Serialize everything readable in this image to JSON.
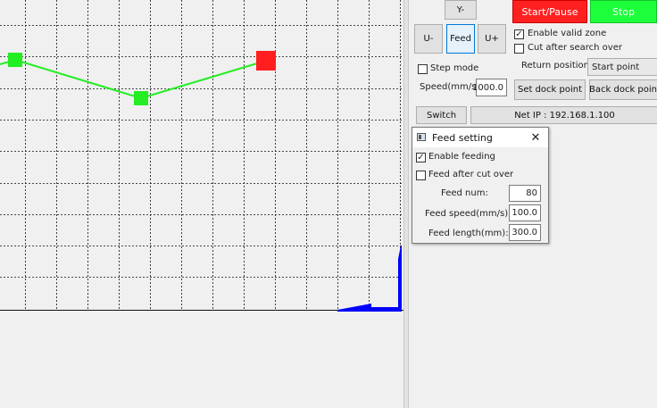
{
  "jog": {
    "y_minus": "Y-",
    "u_minus": "U-",
    "feed": "Feed",
    "u_plus": "U+"
  },
  "controls": {
    "start_pause": "Start/Pause",
    "stop": "Stop",
    "start_color": "#ff2020",
    "stop_color": "#1eff3c"
  },
  "options": {
    "enable_valid_zone": {
      "label": "Enable valid zone",
      "checked": true
    },
    "cut_after_search_over": {
      "label": "Cut after search over",
      "checked": false
    },
    "return_position_label": "Return position:",
    "return_position_value": "Start point",
    "step_mode": {
      "label": "Step mode",
      "checked": false
    },
    "speed_label": "Speed(mm/s):",
    "speed_value": "1000.0",
    "set_dock_point": "Set dock point",
    "back_dock_point": "Back dock point"
  },
  "network": {
    "switch_label": "Switch",
    "net_ip": "Net IP : 192.168.1.100"
  },
  "feed_dialog": {
    "title": "Feed setting",
    "close_glyph": "✕",
    "enable_feeding": {
      "label": "Enable feeding",
      "checked": true
    },
    "feed_after_cut_over": {
      "label": "Feed after cut over",
      "checked": false
    },
    "feed_num_label": "Feed num:",
    "feed_num_value": "80",
    "feed_speed_label": "Feed speed(mm/s):",
    "feed_speed_value": "100.0",
    "feed_length_label": "Feed length(mm):",
    "feed_length_value": "300.0"
  },
  "canvas": {
    "path_color": "#22ee22",
    "start_marker_color": "#ff1f1f",
    "point_color": "#22ee22",
    "axis_color": "#0000ff"
  }
}
